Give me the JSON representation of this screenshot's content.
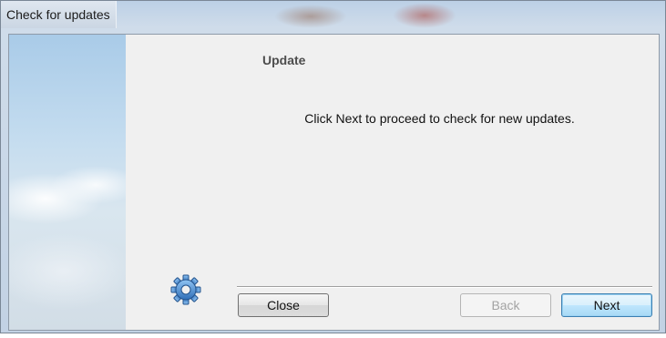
{
  "window": {
    "title": "Check for updates"
  },
  "content": {
    "heading": "Update",
    "message": "Click Next to proceed to check for new updates."
  },
  "buttons": {
    "close": "Close",
    "back": "Back",
    "next": "Next"
  },
  "icons": {
    "wizard": "gear-icon"
  },
  "colors": {
    "gear": "#3d86d6",
    "default_button_border": "#3c7fb1"
  }
}
